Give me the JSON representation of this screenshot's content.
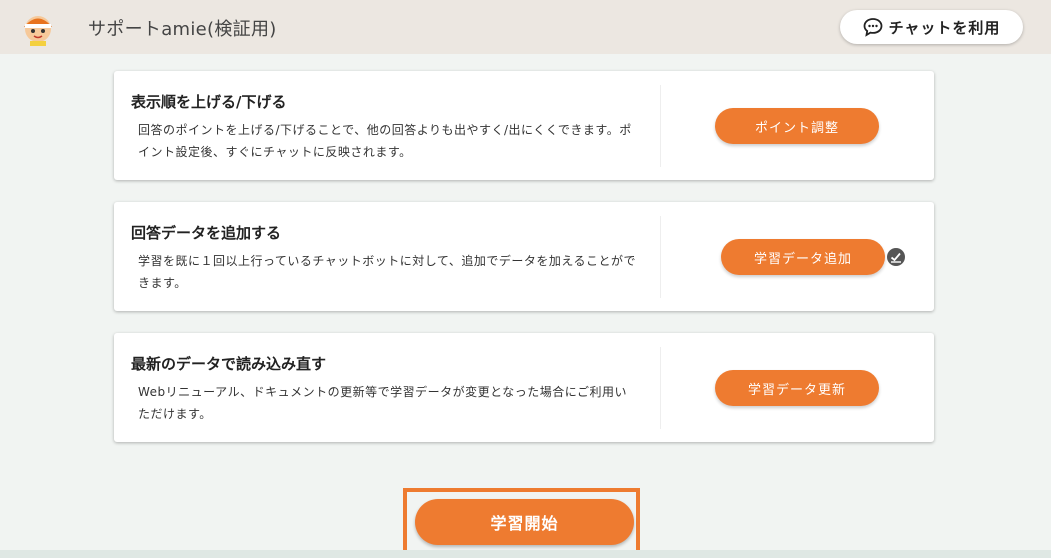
{
  "header": {
    "title": "サポートamie(検証用)",
    "chat_button_label": "チャットを利用",
    "logo_icon": "amie-mascot-logo",
    "chat_icon": "chat-bubble-icon"
  },
  "cards": [
    {
      "title": "表示順を上げる/下げる",
      "description": "回答のポイントを上げる/下げることで、他の回答よりも出やすく/出にくくできます。ポイント設定後、すぐにチャットに反映されます。",
      "button_label": "ポイント調整"
    },
    {
      "title": "回答データを追加する",
      "description": "学習を既に１回以上行っているチャットボットに対して、追加でデータを加えることができます。",
      "button_label": "学習データ追加",
      "status_icon": "check-badge-icon"
    },
    {
      "title": "最新のデータで読み込み直す",
      "description": "Webリニューアル、ドキュメントの更新等で学習データが変更となった場合にご利用いただけます。",
      "button_label": "学習データ更新"
    }
  ],
  "start_button_label": "学習開始",
  "colors": {
    "accent": "#ee7b30",
    "header_bg": "#ece7e1",
    "page_bg": "#f1f4f2"
  }
}
